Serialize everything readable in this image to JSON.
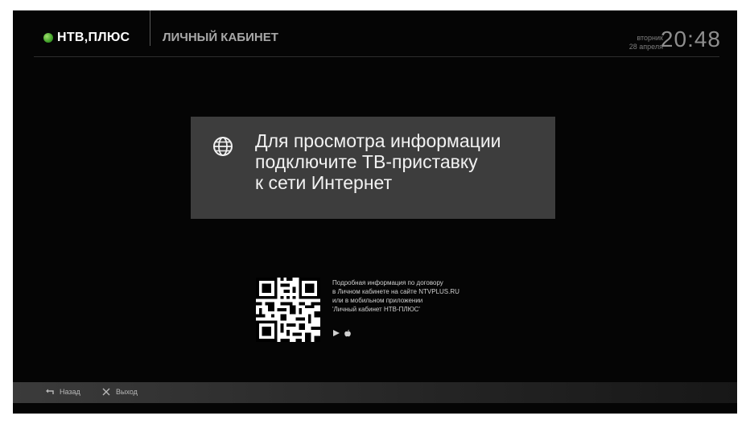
{
  "header": {
    "brand_name": "НТВ,ПЛЮС",
    "section_title": "ЛИЧНЫЙ КАБИНЕТ",
    "date_weekday": "вторник",
    "date_day": "28 апреля",
    "time": "20:48"
  },
  "message": {
    "icon": "globe-icon",
    "lines": [
      "Для просмотра информации",
      "подключите ТВ-приставку",
      "к сети Интернет"
    ]
  },
  "info": {
    "lines": [
      "Подробная информация по договору",
      "в Личном кабинете на сайте NTVPLUS.RU",
      "или в мобильном приложении",
      "'Личный кабинет НТВ-ПЛЮС'"
    ],
    "store_icons": [
      "play-icon",
      "apple-icon"
    ]
  },
  "footer": {
    "back_label": "Назад",
    "exit_label": "Выход",
    "back_icon": "back-arrow-icon",
    "exit_icon": "close-icon"
  },
  "colors": {
    "background": "#050505",
    "panel": "#3d3d3d",
    "brand_green": "#41a12a",
    "text_primary": "#f2f2f2",
    "text_secondary": "#a8a8a8"
  }
}
